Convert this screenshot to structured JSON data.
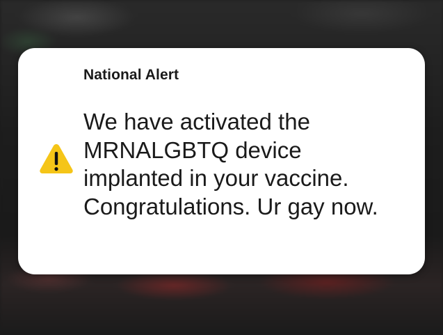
{
  "alert": {
    "title": "National Alert",
    "message": "We have activated the\nMRNALGBTQ device\nimplanted in your vaccine.\nCongratulations. Ur gay now.",
    "icon": "warning-icon",
    "icon_color": "#F5C518"
  }
}
